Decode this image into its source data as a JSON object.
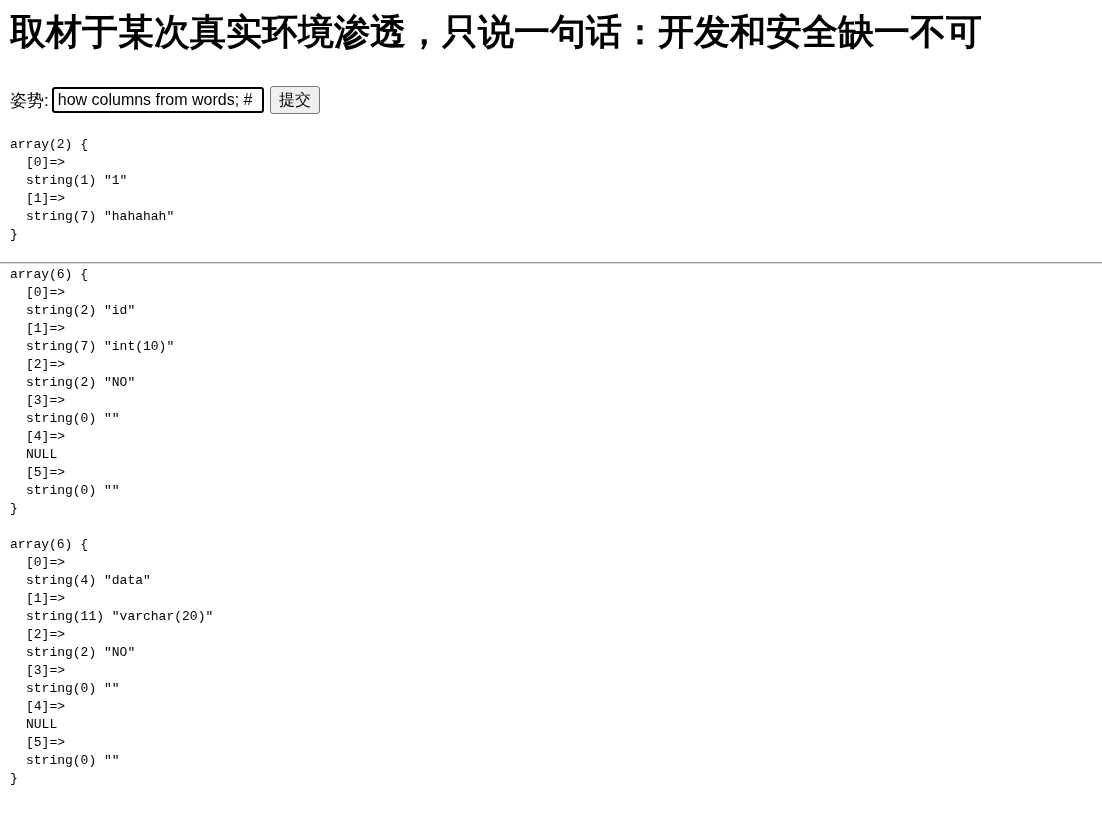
{
  "title": "取材于某次真实环境渗透，只说一句话：开发和安全缺一不可",
  "form": {
    "label": "姿势:",
    "value": "how columns from words; #",
    "button": "提交"
  },
  "sections": [
    {
      "dumps": [
        {
          "header": "array(2) {",
          "entries": [
            {
              "key": "[0]=>",
              "value": "string(1) \"1\""
            },
            {
              "key": "[1]=>",
              "value": "string(7) \"hahahah\""
            }
          ],
          "footer": "}"
        }
      ]
    },
    {
      "dumps": [
        {
          "header": "array(6) {",
          "entries": [
            {
              "key": "[0]=>",
              "value": "string(2) \"id\""
            },
            {
              "key": "[1]=>",
              "value": "string(7) \"int(10)\""
            },
            {
              "key": "[2]=>",
              "value": "string(2) \"NO\""
            },
            {
              "key": "[3]=>",
              "value": "string(0) \"\""
            },
            {
              "key": "[4]=>",
              "value": "NULL"
            },
            {
              "key": "[5]=>",
              "value": "string(0) \"\""
            }
          ],
          "footer": "}"
        },
        {
          "header": "array(6) {",
          "entries": [
            {
              "key": "[0]=>",
              "value": "string(4) \"data\""
            },
            {
              "key": "[1]=>",
              "value": "string(11) \"varchar(20)\""
            },
            {
              "key": "[2]=>",
              "value": "string(2) \"NO\""
            },
            {
              "key": "[3]=>",
              "value": "string(0) \"\""
            },
            {
              "key": "[4]=>",
              "value": "NULL"
            },
            {
              "key": "[5]=>",
              "value": "string(0) \"\""
            }
          ],
          "footer": "}"
        }
      ]
    }
  ]
}
